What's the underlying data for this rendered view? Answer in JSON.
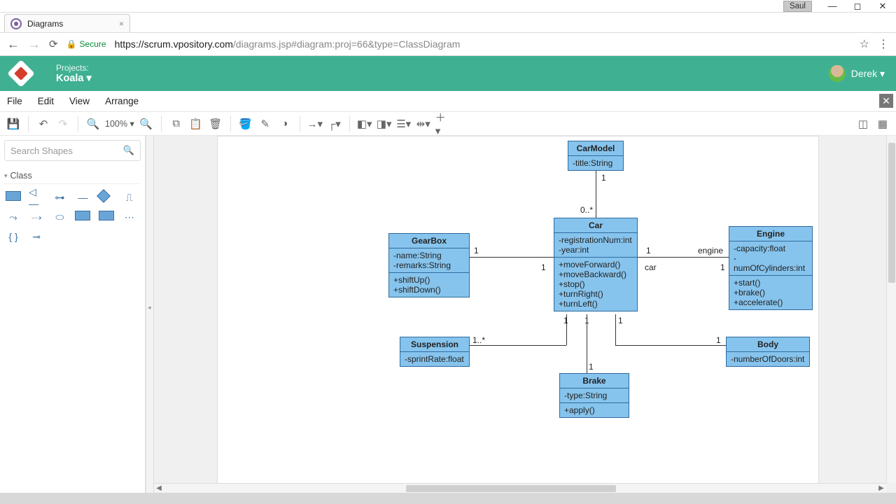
{
  "os": {
    "user_tag": "Saul"
  },
  "browser": {
    "tab_title": "Diagrams",
    "secure_label": "Secure",
    "url_host": "https://scrum.vpository.com",
    "url_path": "/diagrams.jsp#diagram:proj=66&type=ClassDiagram"
  },
  "header": {
    "projects_label": "Projects:",
    "project_name": "Koala",
    "user_name": "Derek"
  },
  "menus": {
    "file": "File",
    "edit": "Edit",
    "view": "View",
    "arrange": "Arrange"
  },
  "toolbar": {
    "zoom": "100%"
  },
  "sidebar": {
    "search_placeholder": "Search Shapes",
    "palette_title": "Class"
  },
  "diagram": {
    "classes": {
      "CarModel": {
        "name": "CarModel",
        "attrs": [
          "-title:String"
        ],
        "ops": []
      },
      "Car": {
        "name": "Car",
        "attrs": [
          "-registrationNum:int",
          "-year:int"
        ],
        "ops": [
          "+moveForward()",
          "+moveBackward()",
          "+stop()",
          "+turnRight()",
          "+turnLeft()"
        ]
      },
      "GearBox": {
        "name": "GearBox",
        "attrs": [
          "-name:String",
          "-remarks:String"
        ],
        "ops": [
          "+shiftUp()",
          "+shiftDown()"
        ]
      },
      "Engine": {
        "name": "Engine",
        "attrs": [
          "-capacity:float",
          "-numOfCylinders:int"
        ],
        "ops": [
          "+start()",
          "+brake()",
          "+accelerate()"
        ]
      },
      "Suspension": {
        "name": "Suspension",
        "attrs": [
          "-sprintRate:float"
        ],
        "ops": []
      },
      "Body": {
        "name": "Body",
        "attrs": [
          "-numberOfDoors:int"
        ],
        "ops": []
      },
      "Brake": {
        "name": "Brake",
        "attrs": [
          "-type:String"
        ],
        "ops": [
          "+apply()"
        ]
      }
    },
    "labels": {
      "m_carmodel_top": "1",
      "m_carmodel_bot": "0..*",
      "m_car_gear_l": "1",
      "m_car_gear_r": "1",
      "m_car_eng_l": "1",
      "m_car_eng_r": "1",
      "role_engine": "engine",
      "role_car": "car",
      "m_car_susp_t": "1",
      "m_car_susp_b": "1..*",
      "m_car_brake_t": "1",
      "m_car_brake_b": "1",
      "m_car_body_t": "1",
      "m_car_body_b": "1"
    }
  }
}
